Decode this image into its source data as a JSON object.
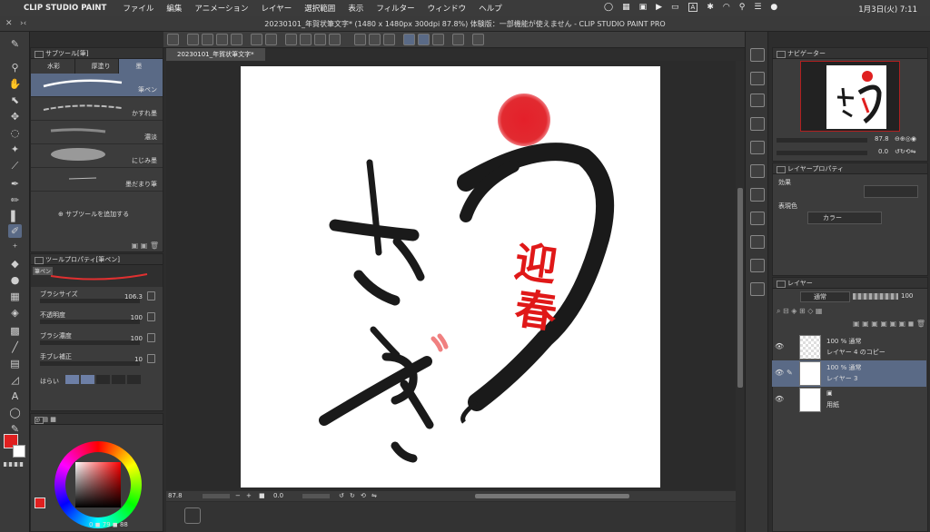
{
  "menubar": {
    "app_name": "CLIP STUDIO PAINT",
    "items": [
      "ファイル",
      "編集",
      "アニメーション",
      "レイヤー",
      "選択範囲",
      "表示",
      "フィルター",
      "ウィンドウ",
      "ヘルプ"
    ],
    "input_mode": "A",
    "clock": "1月3日(火)  7:11"
  },
  "window": {
    "title": "20230101_年賀状筆文字* (1480 x 1480px 300dpi 87.8%)  体験版：一部機能が使えません - CLIP STUDIO PAINT PRO",
    "doc_tab": "20230101_年賀状筆文字*"
  },
  "subtool": {
    "panel_title": "サブツール[筆]",
    "tabs": [
      "水彩",
      "厚塗り",
      "墨"
    ],
    "brushes": [
      "筆ペン",
      "かすれ墨",
      "濃淡",
      "にじみ墨",
      "墨だまり筆"
    ],
    "add_label": "サブツールを追加する"
  },
  "toolprop": {
    "panel_title": "ツールプロパティ[筆ペン]",
    "preview_label": "筆ペン",
    "rows": [
      {
        "label": "ブラシサイズ",
        "value": "106.3"
      },
      {
        "label": "不透明度",
        "value": "100"
      },
      {
        "label": "ブラシ濃度",
        "value": "100"
      },
      {
        "label": "手ブレ補正",
        "value": "10"
      }
    ],
    "harai_label": "はらい"
  },
  "color": {
    "main": "#e02020",
    "sub": "#ffffff",
    "readout": [
      "0",
      "79",
      "88"
    ]
  },
  "canvas": {
    "zoom": "87.8",
    "rotation": "0.0",
    "artwork": {
      "label_geishun": "迎春",
      "seal_color": "#e0202a",
      "ink_color": "#1a1a1a"
    }
  },
  "navigator": {
    "panel_title": "ナビゲーター",
    "zoom": "87.8",
    "rotation": "0.0"
  },
  "layerprop": {
    "panel_title": "レイヤープロパティ",
    "effect_label": "効果",
    "display_color_label": "表現色",
    "display_color_value": "カラー"
  },
  "layers": {
    "panel_title": "レイヤー",
    "blend_mode": "通常",
    "opacity": "100",
    "items": [
      {
        "percent": "100 %",
        "mode": "通常",
        "name": "レイヤー 4 のコピー"
      },
      {
        "percent": "100 %",
        "mode": "通常",
        "name": "レイヤー 3"
      },
      {
        "name": "用紙"
      }
    ]
  }
}
